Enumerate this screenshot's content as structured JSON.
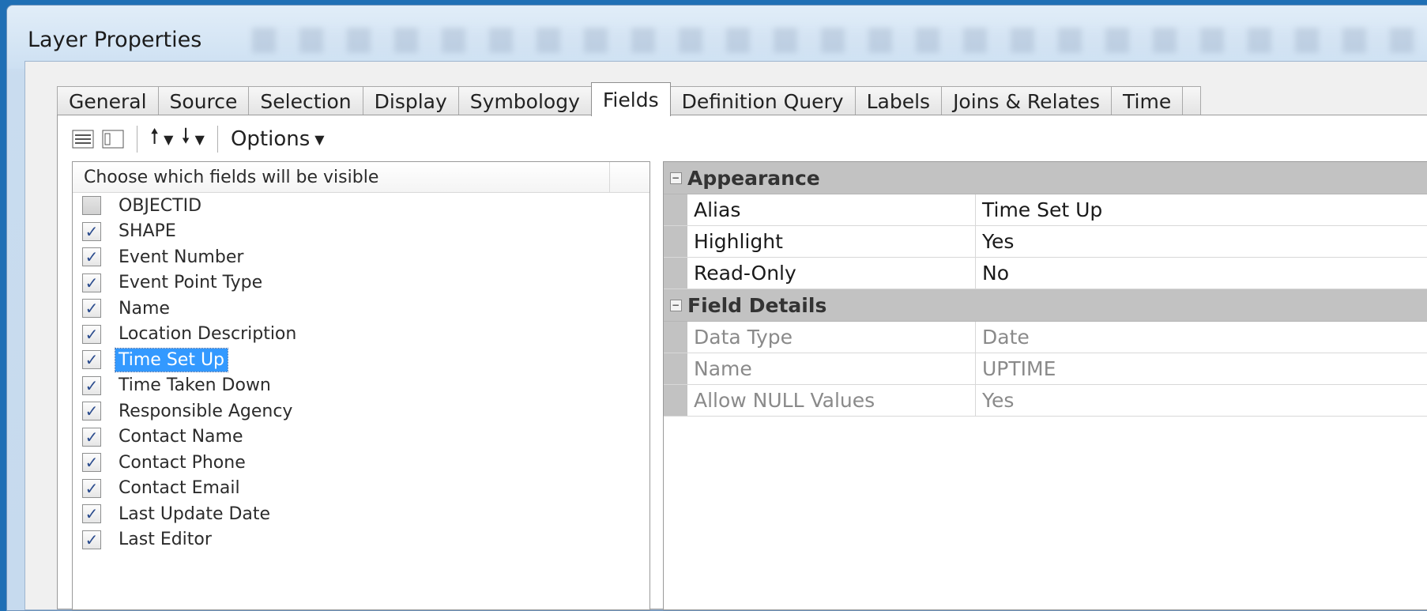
{
  "window": {
    "title": "Layer Properties"
  },
  "tabs": [
    {
      "label": "General"
    },
    {
      "label": "Source"
    },
    {
      "label": "Selection"
    },
    {
      "label": "Display"
    },
    {
      "label": "Symbology"
    },
    {
      "label": "Fields",
      "active": true
    },
    {
      "label": "Definition Query"
    },
    {
      "label": "Labels"
    },
    {
      "label": "Joins & Relates"
    },
    {
      "label": "Time"
    }
  ],
  "toolbar": {
    "options_label": "Options"
  },
  "field_list": {
    "header": "Choose which fields will be visible",
    "items": [
      {
        "label": "OBJECTID",
        "checked": false
      },
      {
        "label": "SHAPE",
        "checked": true
      },
      {
        "label": "Event Number",
        "checked": true
      },
      {
        "label": "Event Point Type",
        "checked": true
      },
      {
        "label": "Name",
        "checked": true
      },
      {
        "label": "Location Description",
        "checked": true
      },
      {
        "label": "Time Set Up",
        "checked": true,
        "selected": true
      },
      {
        "label": "Time Taken Down",
        "checked": true
      },
      {
        "label": "Responsible Agency",
        "checked": true
      },
      {
        "label": "Contact Name",
        "checked": true
      },
      {
        "label": "Contact Phone",
        "checked": true
      },
      {
        "label": "Contact Email",
        "checked": true
      },
      {
        "label": "Last Update Date",
        "checked": true
      },
      {
        "label": "Last Editor",
        "checked": true
      }
    ]
  },
  "property_grid": {
    "appearance": {
      "title": "Appearance",
      "rows": [
        {
          "key": "Alias",
          "value": "Time Set Up"
        },
        {
          "key": "Highlight",
          "value": "Yes"
        },
        {
          "key": "Read-Only",
          "value": "No"
        }
      ]
    },
    "field_details": {
      "title": "Field Details",
      "rows": [
        {
          "key": "Data Type",
          "value": "Date"
        },
        {
          "key": "Name",
          "value": "UPTIME"
        },
        {
          "key": "Allow NULL Values",
          "value": "Yes"
        }
      ]
    }
  },
  "colors": {
    "selection": "#3399ff",
    "category": "#c2c2c2",
    "outer": "#1f6fb5"
  }
}
